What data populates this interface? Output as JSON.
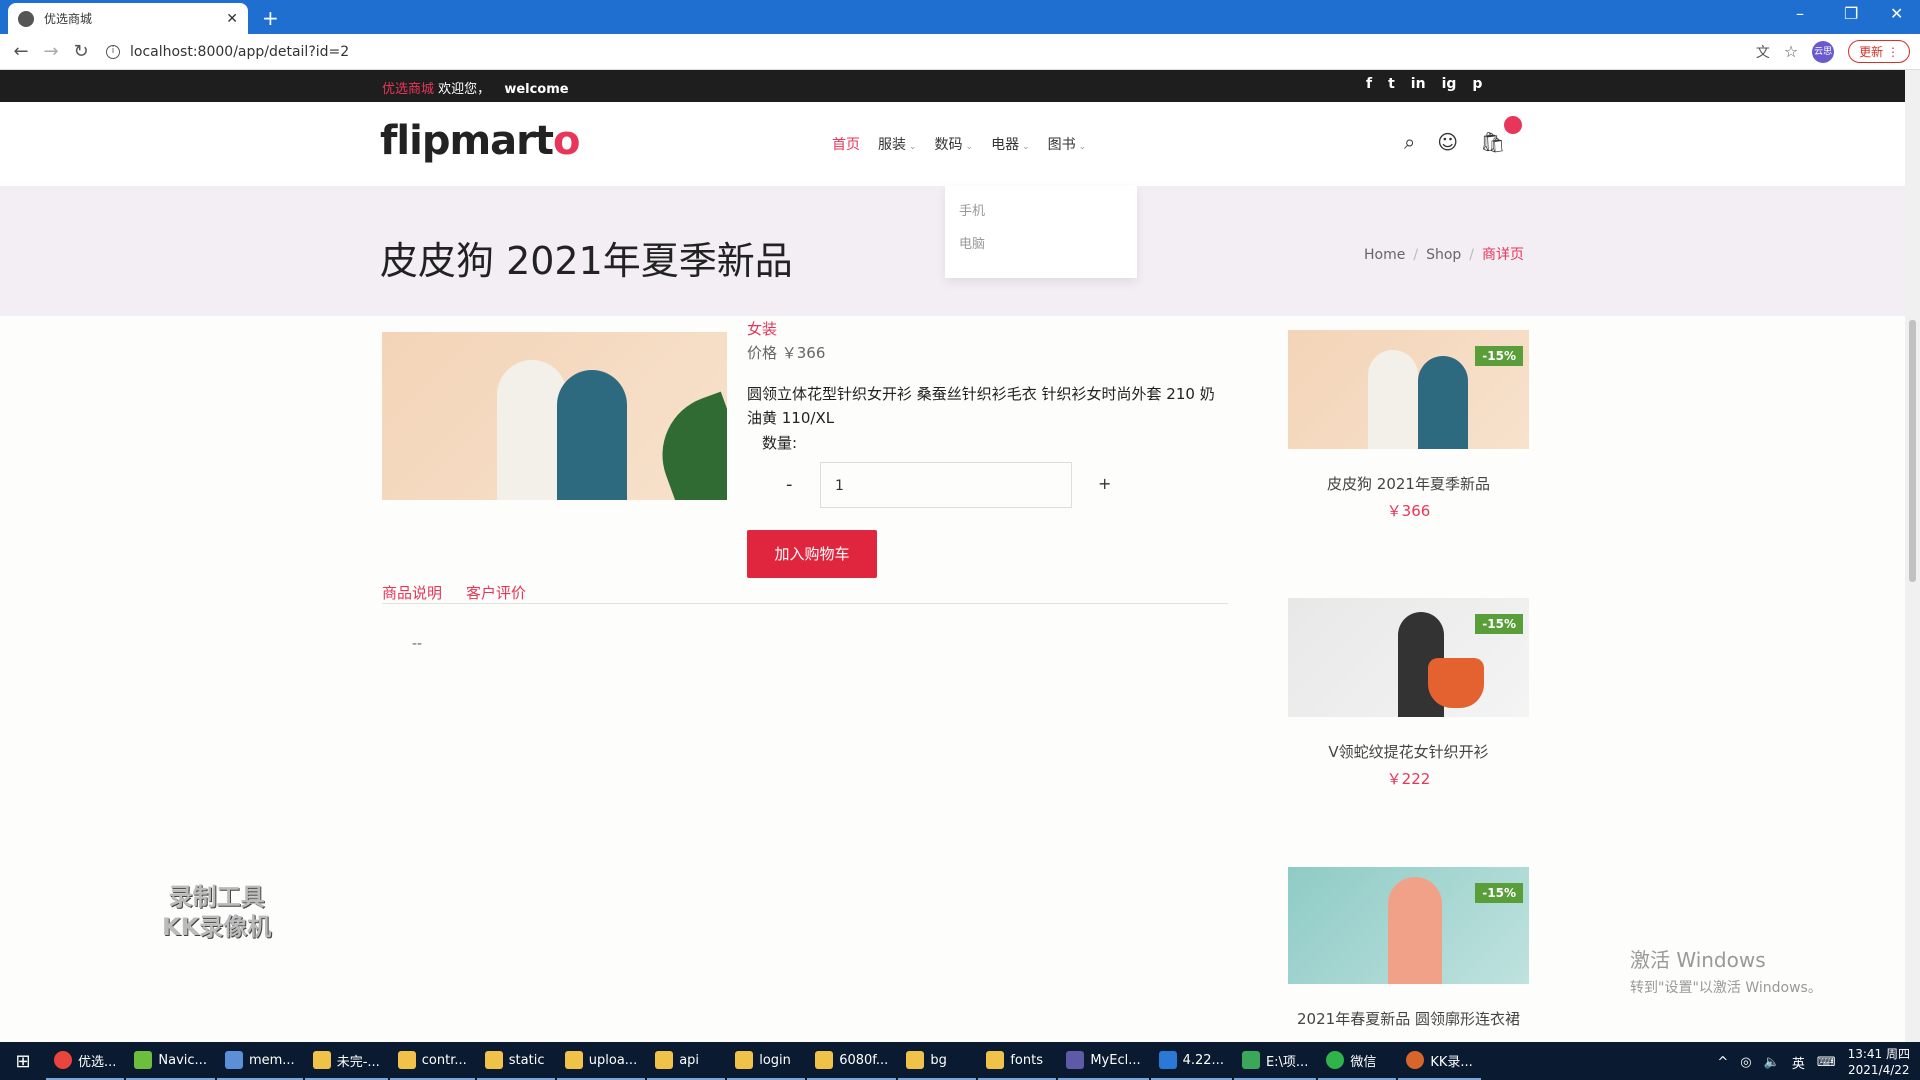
{
  "browser": {
    "tab_title": "优选商城",
    "url": "localhost:8000/app/detail?id=2",
    "update_label": "更新",
    "profile_label": "云思"
  },
  "topbar": {
    "brand": "优选商城",
    "welcome_cn": "欢迎您，",
    "welcome_en": "welcome",
    "social": [
      "f",
      "t",
      "in",
      "ig",
      "p"
    ]
  },
  "header": {
    "logo_text": "flipmart",
    "logo_dot": "o",
    "menu": [
      {
        "label": "首页"
      },
      {
        "label": "服装"
      },
      {
        "label": "数码"
      },
      {
        "label": "电器"
      },
      {
        "label": "图书"
      }
    ],
    "dropdown": [
      "手机",
      "电脑"
    ]
  },
  "banner": {
    "title": "皮皮狗 2021年夏季新品",
    "crumbs": [
      "Home",
      "Shop",
      "商详页"
    ]
  },
  "product": {
    "category": "女装",
    "price": "价格 ￥366",
    "description": "圆领立体花型针织女开衫 桑蚕丝针织衫毛衣 针织衫女时尚外套 210 奶油黄 110/XL",
    "qty_label": "数量:",
    "qty_minus": "-",
    "qty_value": "1",
    "qty_plus": "+",
    "add_to_cart": "加入购物车",
    "tabs": [
      "商品说明",
      "客户评价"
    ],
    "tab_content": "--"
  },
  "sidebar": [
    {
      "badge": "-15%",
      "name": "皮皮狗 2021年夏季新品",
      "price": "￥366"
    },
    {
      "badge": "-15%",
      "name": "V领蛇纹提花女针织开衫",
      "price": "￥222"
    },
    {
      "badge": "-15%",
      "name": "2021年春夏新品 圆领廓形连衣裙",
      "price": ""
    }
  ],
  "watermark": {
    "line1": "录制工具",
    "line2": "KK录像机"
  },
  "windows_activate": {
    "line1": "激活 Windows",
    "line2": "转到\"设置\"以激活 Windows。"
  },
  "taskbar": {
    "items": [
      "优选...",
      "Navic...",
      "mem...",
      "未完-...",
      "contr...",
      "static",
      "uploa...",
      "api",
      "login",
      "6080f...",
      "bg",
      "fonts",
      "MyEcl...",
      "4.22...",
      "E:\\项...",
      "微信",
      "KK录..."
    ],
    "lang": "英",
    "time": "13:41 周四",
    "date": "2021/4/22"
  },
  "colors": {
    "accent": "#e8365a",
    "button": "#e0263e",
    "badge": "#5a9e3a",
    "banner_bg": "#f2eef4"
  }
}
